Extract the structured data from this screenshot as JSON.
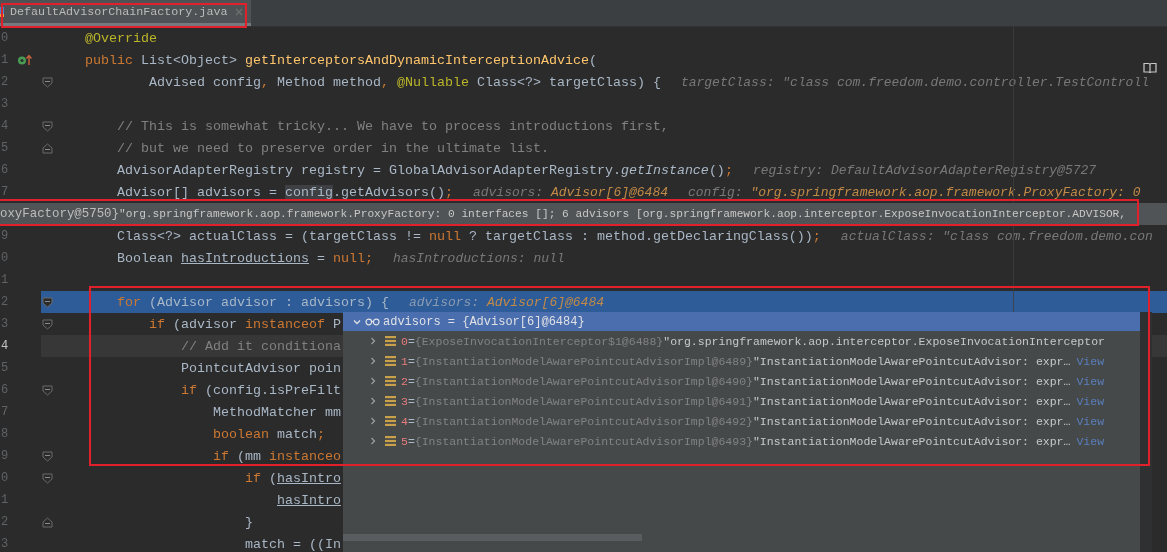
{
  "tab": {
    "label": "DefaultAdvisorChainFactory.java",
    "selected": true
  },
  "editor": {
    "lines": [
      {
        "kind": "code",
        "number": "0",
        "selected": false,
        "current": false,
        "code": [
          {
            "kind": "annotation",
            "text": "@Override"
          }
        ]
      },
      {
        "kind": "code",
        "number": "1",
        "selected": false,
        "current": false,
        "marker": {
          "kind": "override"
        },
        "code": [
          {
            "kind": "keyword",
            "text": "public"
          },
          {
            "kind": "plain",
            "text": " List<Object> "
          },
          {
            "kind": "method",
            "text": "getInterceptorsAndDynamicInterceptionAdvice"
          },
          {
            "kind": "plain",
            "text": "("
          }
        ]
      },
      {
        "kind": "code",
        "number": "2",
        "selected": false,
        "current": false,
        "fold": {
          "kind": "start"
        },
        "code": [
          {
            "kind": "plain",
            "text": "        Advised config"
          },
          {
            "kind": "keyword",
            "text": ", "
          },
          {
            "kind": "plain",
            "text": "Method method"
          },
          {
            "kind": "keyword",
            "text": ", "
          },
          {
            "kind": "annotation",
            "text": "@Nullable"
          },
          {
            "kind": "plain",
            "text": " Class<?> targetClass) {"
          }
        ],
        "hints": [
          {
            "label": "targetClass: \"class com.freedom.demo.controller.TestControll"
          }
        ]
      },
      {
        "kind": "code",
        "number": "3",
        "selected": false,
        "current": false
      },
      {
        "kind": "code",
        "number": "4",
        "selected": false,
        "current": false,
        "fold": {
          "kind": "start"
        },
        "code": [
          {
            "kind": "comment",
            "text": "    // This is somewhat tricky... We have to process introductions first,"
          }
        ]
      },
      {
        "kind": "code",
        "number": "5",
        "selected": false,
        "current": false,
        "fold": {
          "kind": "end"
        },
        "code": [
          {
            "kind": "comment",
            "text": "    // but we need to preserve order in the ultimate list."
          }
        ]
      },
      {
        "kind": "code",
        "number": "6",
        "selected": false,
        "current": false,
        "code": [
          {
            "kind": "plain",
            "text": "    AdvisorAdapterRegistry registry = GlobalAdvisorAdapterRegistry."
          },
          {
            "kind": "static",
            "text": "getInstance"
          },
          {
            "kind": "plain",
            "text": "()"
          },
          {
            "kind": "keyword",
            "text": ";"
          }
        ],
        "hints": [
          {
            "label": "registry: DefaultAdvisorAdapterRegistry@5727"
          }
        ]
      },
      {
        "kind": "code",
        "number": "7",
        "selected": false,
        "current": false,
        "code": [
          {
            "kind": "plain",
            "text": "    Advisor[] advisors = "
          },
          {
            "kind": "highlight",
            "text": "config"
          },
          {
            "kind": "plain",
            "text": ".getAdvisors()"
          },
          {
            "kind": "keyword",
            "text": ";"
          }
        ],
        "hints": [
          {
            "label": "advisors: ",
            "value": "Advisor[6]@6484"
          },
          {
            "label": "config: ",
            "value": "\"org.springframework.aop.framework.ProxyFactory: 0"
          }
        ]
      },
      {
        "kind": "tooltip",
        "type_text": "oxyFactory@5750}",
        "value": "\"org.springframework.aop.framework.ProxyFactory: 0 interfaces []; 6 advisors [org.springframework.aop.interceptor.ExposeInvocationInterceptor.ADVISOR,"
      },
      {
        "kind": "code",
        "number": "9",
        "selected": false,
        "current": false,
        "code": [
          {
            "kind": "plain",
            "text": "    Class<?> actualClass = (targetClass != "
          },
          {
            "kind": "keyword",
            "text": "null"
          },
          {
            "kind": "plain",
            "text": " ? targetClass : method.getDeclaringClass())"
          },
          {
            "kind": "keyword",
            "text": ";"
          }
        ],
        "hints": [
          {
            "label": "actualClass: \"class com.freedom.demo.con"
          }
        ]
      },
      {
        "kind": "code",
        "number": "0",
        "selected": false,
        "current": false,
        "code": [
          {
            "kind": "plain",
            "text": "    Boolean "
          },
          {
            "kind": "field",
            "text": "hasIntroductions"
          },
          {
            "kind": "plain",
            "text": " = "
          },
          {
            "kind": "keyword",
            "text": "null;"
          }
        ],
        "hints": [
          {
            "label": "hasIntroductions: null"
          }
        ]
      },
      {
        "kind": "code",
        "number": "1",
        "selected": false,
        "current": false
      },
      {
        "kind": "code",
        "number": "2",
        "selected": true,
        "current": false,
        "fold": {
          "kind": "start"
        },
        "code": [
          {
            "kind": "keyword",
            "text": "    for"
          },
          {
            "kind": "plain",
            "text": " (Advisor advisor : advisors) {"
          }
        ],
        "hints": [
          {
            "label": "advisors: ",
            "value": "Advisor[6]@6484"
          }
        ]
      },
      {
        "kind": "code",
        "number": "3",
        "selected": false,
        "current": false,
        "fold": {
          "kind": "start"
        },
        "code": [
          {
            "kind": "keyword",
            "text": "        if"
          },
          {
            "kind": "plain",
            "text": " (advisor "
          },
          {
            "kind": "keyword",
            "text": "instanceof"
          },
          {
            "kind": "plain",
            "text": " P"
          }
        ]
      },
      {
        "kind": "code",
        "number": "4",
        "selected": false,
        "current": true,
        "code": [
          {
            "kind": "comment",
            "text": "            // Add it conditiona"
          }
        ]
      },
      {
        "kind": "code",
        "number": "5",
        "selected": false,
        "current": false,
        "code": [
          {
            "kind": "plain",
            "text": "            PointcutAdvisor poin"
          }
        ]
      },
      {
        "kind": "code",
        "number": "6",
        "selected": false,
        "current": false,
        "fold": {
          "kind": "start"
        },
        "code": [
          {
            "kind": "keyword",
            "text": "            if"
          },
          {
            "kind": "plain",
            "text": " (config.isPreFilt"
          }
        ]
      },
      {
        "kind": "code",
        "number": "7",
        "selected": false,
        "current": false,
        "code": [
          {
            "kind": "plain",
            "text": "                MethodMatcher mm"
          }
        ]
      },
      {
        "kind": "code",
        "number": "8",
        "selected": false,
        "current": false,
        "code": [
          {
            "kind": "keyword",
            "text": "                boolean"
          },
          {
            "kind": "plain",
            "text": " match"
          },
          {
            "kind": "keyword",
            "text": ";"
          }
        ]
      },
      {
        "kind": "code",
        "number": "9",
        "selected": false,
        "current": false,
        "fold": {
          "kind": "start"
        },
        "code": [
          {
            "kind": "keyword",
            "text": "                if"
          },
          {
            "kind": "plain",
            "text": " (mm "
          },
          {
            "kind": "keyword",
            "text": "instanceo"
          }
        ]
      },
      {
        "kind": "code",
        "number": "0",
        "selected": false,
        "current": false,
        "fold": {
          "kind": "start"
        },
        "code": [
          {
            "kind": "keyword",
            "text": "                    if"
          },
          {
            "kind": "plain",
            "text": " ("
          },
          {
            "kind": "field",
            "text": "hasIntro"
          }
        ]
      },
      {
        "kind": "code",
        "number": "1",
        "selected": false,
        "current": false,
        "code": [
          {
            "kind": "field",
            "text": "                        hasIntro"
          }
        ]
      },
      {
        "kind": "code",
        "number": "2",
        "selected": false,
        "current": false,
        "fold": {
          "kind": "end"
        },
        "code": [
          {
            "kind": "plain",
            "text": "                    }"
          }
        ]
      },
      {
        "kind": "code",
        "number": "3",
        "selected": false,
        "current": false,
        "code": [
          {
            "kind": "plain",
            "text": "                    match = ((In"
          }
        ]
      }
    ]
  },
  "popup": {
    "root": {
      "label": "advisors = {Advisor[6]@6484}",
      "expanded": true,
      "selected": true
    },
    "items": [
      {
        "index": "0",
        "operator": "=",
        "type": "{ExposeInvocationInterceptor$1@6488}",
        "value": "\"org.springframework.aop.interceptor.ExposeInvocationInterceptor",
        "expanded": false,
        "selected": false
      },
      {
        "index": "1",
        "operator": "=",
        "type": "{InstantiationModelAwarePointcutAdvisorImpl@6489}",
        "value": "\"InstantiationModelAwarePointcutAdvisor: expr…",
        "link": "View",
        "expanded": false,
        "selected": false
      },
      {
        "index": "2",
        "operator": "=",
        "type": "{InstantiationModelAwarePointcutAdvisorImpl@6490}",
        "value": "\"InstantiationModelAwarePointcutAdvisor: expr…",
        "link": "View",
        "expanded": false,
        "selected": false
      },
      {
        "index": "3",
        "operator": "=",
        "type": "{InstantiationModelAwarePointcutAdvisorImpl@6491}",
        "value": "\"InstantiationModelAwarePointcutAdvisor: expr…",
        "link": "View",
        "expanded": false,
        "selected": false
      },
      {
        "index": "4",
        "operator": "=",
        "type": "{InstantiationModelAwarePointcutAdvisorImpl@6492}",
        "value": "\"InstantiationModelAwarePointcutAdvisor: expr…",
        "link": "View",
        "expanded": false,
        "selected": false
      },
      {
        "index": "5",
        "operator": "=",
        "type": "{InstantiationModelAwarePointcutAdvisorImpl@6493}",
        "value": "\"InstantiationModelAwarePointcutAdvisor: expr…",
        "link": "View",
        "expanded": false,
        "selected": false
      }
    ]
  }
}
